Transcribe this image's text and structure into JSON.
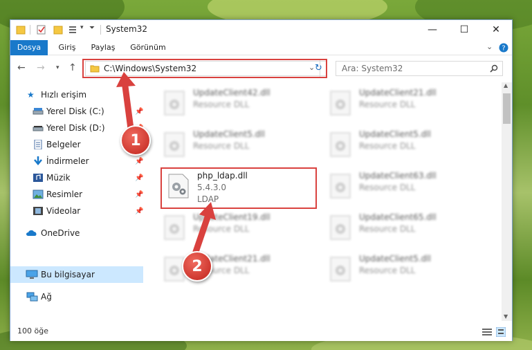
{
  "window": {
    "title": "System32",
    "minimize_glyph": "—",
    "maximize_glyph": "☐",
    "close_glyph": "✕"
  },
  "ribbon": {
    "tabs": [
      {
        "label": "Dosya"
      },
      {
        "label": "Giriş"
      },
      {
        "label": "Paylaş"
      },
      {
        "label": "Görünüm"
      }
    ]
  },
  "address": {
    "path": "C:\\Windows\\System32",
    "search_placeholder": "Ara: System32"
  },
  "sidebar": {
    "items": [
      {
        "label": "Hızlı erişim",
        "icon": "star-icon"
      },
      {
        "label": "Yerel Disk (C:)",
        "icon": "drive-icon",
        "pinned": true
      },
      {
        "label": "Yerel Disk (D:)",
        "icon": "drive-icon",
        "pinned": true
      },
      {
        "label": "Belgeler",
        "icon": "document-icon",
        "pinned": true
      },
      {
        "label": "İndirmeler",
        "icon": "download-icon",
        "pinned": true
      },
      {
        "label": "Müzik",
        "icon": "music-icon",
        "pinned": true
      },
      {
        "label": "Resimler",
        "icon": "picture-icon",
        "pinned": true
      },
      {
        "label": "Videolar",
        "icon": "video-icon",
        "pinned": true
      },
      {
        "label": "OneDrive",
        "icon": "cloud-icon"
      },
      {
        "label": "Bu bilgisayar",
        "icon": "computer-icon",
        "selected": true
      },
      {
        "label": "Ağ",
        "icon": "network-icon"
      }
    ]
  },
  "files": {
    "left": [
      {
        "name": "UpdateClient42.dll",
        "line1": "Resource DLL",
        "line2": ""
      },
      {
        "name": "UpdateClient5.dll",
        "line1": "Resource DLL",
        "line2": ""
      },
      {
        "name": "php_ldap.dll",
        "line1": "5.4.3.0",
        "line2": "LDAP"
      },
      {
        "name": "UpdateClient19.dll",
        "line1": "Resource DLL",
        "line2": ""
      },
      {
        "name": "UpdateClient21.dll",
        "line1": "Resource DLL",
        "line2": ""
      }
    ],
    "right": [
      {
        "name": "UpdateClient21.dll",
        "line1": "Resource DLL"
      },
      {
        "name": "UpdateClient5.dll",
        "line1": "Resource DLL"
      },
      {
        "name": "UpdateClient63.dll",
        "line1": "Resource DLL"
      },
      {
        "name": "UpdateClient65.dll",
        "line1": "Resource DLL"
      },
      {
        "name": "UpdateClient5.dll",
        "line1": "Resource DLL"
      }
    ]
  },
  "status": {
    "count": "100 öğe"
  },
  "annotations": {
    "badge1": "1",
    "badge2": "2",
    "accent_color": "#d9413e"
  }
}
